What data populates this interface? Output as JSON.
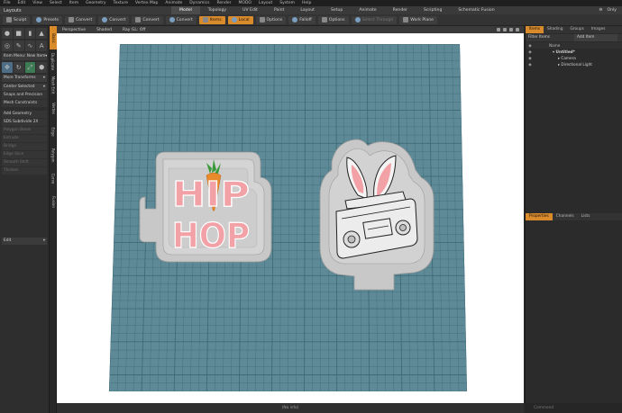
{
  "app": {
    "menu": [
      "File",
      "Edit",
      "View",
      "Select",
      "Item",
      "Geometry",
      "Texture",
      "Vertex Map",
      "Animate",
      "Dynamics",
      "Render",
      "MODO",
      "Layout",
      "System",
      "Help"
    ],
    "layout_title": "Layouts",
    "layout_tabs": [
      "Model",
      "Topology",
      "UV Edit",
      "Paint",
      "Layout",
      "Setup",
      "Animate",
      "Render",
      "Scripting",
      "Schematic Fusion"
    ],
    "active_layout": "Model",
    "right_controls": [
      "Only"
    ]
  },
  "toolbar": {
    "items": [
      {
        "label": "Sculpt",
        "style": "normal"
      },
      {
        "label": "Presets",
        "style": "normal"
      },
      {
        "label": "Convert",
        "style": "normal"
      },
      {
        "label": "Convert",
        "style": "normal"
      },
      {
        "label": "Convert",
        "style": "normal"
      },
      {
        "label": "Convert",
        "style": "normal"
      },
      {
        "label": "Items",
        "style": "orange"
      },
      {
        "label": "Local",
        "style": "orange"
      },
      {
        "label": "Options",
        "style": "normal"
      },
      {
        "label": "Falloff",
        "style": "normal"
      },
      {
        "label": "Options",
        "style": "normal"
      },
      {
        "label": "Select Through",
        "style": "dim"
      },
      {
        "label": "Work Plane",
        "style": "normal"
      }
    ]
  },
  "left_panel": {
    "dropdown_top": "Item Menu: New Item",
    "items": [
      {
        "label": "More Transforms",
        "dim": false,
        "dropdown": true
      },
      {
        "label": "Center Selected",
        "dim": false,
        "dropdown": true
      },
      {
        "label": "Snaps and Precision",
        "dim": false
      },
      {
        "label": "Mesh Constraints",
        "dim": false
      },
      {
        "label": "Add Geometry",
        "dim": false
      },
      {
        "label": "SDS Subdivide 2X",
        "dim": false
      },
      {
        "label": "Polygon Bevel",
        "dim": true
      },
      {
        "label": "Extrude",
        "dim": true
      },
      {
        "label": "Bridge",
        "dim": true
      },
      {
        "label": "Edge Slice",
        "dim": true
      },
      {
        "label": "Smooth Shift",
        "dim": true
      },
      {
        "label": "Thicken",
        "dim": true
      },
      {
        "label": "Edit",
        "dim": false,
        "dropdown": true
      }
    ]
  },
  "vertical_tabs": [
    "Basic",
    "Duplicate",
    "Mesh Edit",
    "Vertex",
    "Edge",
    "Polygon",
    "Curve",
    "Fusion"
  ],
  "viewport": {
    "views": [
      "Perspective",
      "Shaded",
      "Ray GL: Off"
    ],
    "status": "(No info)",
    "colors": {
      "background": "#ffffff",
      "grid_fill": "#5e8a97",
      "grid_line": "#3f6a77",
      "cutter": "#c8c8c8",
      "cutter_edge": "#9c9c9c",
      "pink": "#f2a2a6",
      "carrot": "#e98a2c",
      "leaf": "#3a9a3a"
    },
    "stamps": {
      "left_text_line1": "HIP",
      "left_text_line2": "HOP"
    }
  },
  "item_list": {
    "tabs": [
      "Items",
      "Shading",
      "Groups",
      "Images"
    ],
    "active_tab": "Items",
    "filter_label": "Filter Items",
    "add_label": "Add Item",
    "column": "Name",
    "rows": [
      {
        "label": "Untitled*",
        "indent": 0
      },
      {
        "label": "Camera",
        "indent": 1
      },
      {
        "label": "Directional Light",
        "indent": 1
      }
    ]
  },
  "properties": {
    "tabs": [
      "Properties",
      "Channels",
      "Lists"
    ],
    "active_tab": "Properties"
  },
  "command_bar": "Command"
}
